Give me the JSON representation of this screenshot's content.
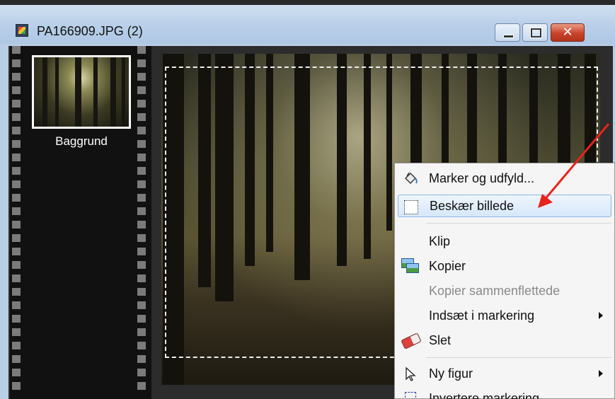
{
  "window": {
    "title": "PA166909.JPG (2)",
    "icon": "image-file-icon",
    "controls": [
      "minimize",
      "maximize",
      "close"
    ]
  },
  "layers": {
    "items": [
      {
        "label": "Baggrund"
      }
    ]
  },
  "context_menu": {
    "items": [
      {
        "label": "Marker og udfyld...",
        "icon": "paint-bucket-icon",
        "enabled": true,
        "submenu": false,
        "highlighted": false
      },
      {
        "label": "Beskær billede",
        "icon": "crop-icon",
        "enabled": true,
        "submenu": false,
        "highlighted": true
      },
      {
        "label": "Klip",
        "icon": null,
        "enabled": true,
        "submenu": false,
        "highlighted": false
      },
      {
        "label": "Kopier",
        "icon": "copy-icon",
        "enabled": true,
        "submenu": false,
        "highlighted": false
      },
      {
        "label": "Kopier sammenflettede",
        "icon": null,
        "enabled": false,
        "submenu": false,
        "highlighted": false
      },
      {
        "label": "Indsæt i markering",
        "icon": null,
        "enabled": true,
        "submenu": true,
        "highlighted": false
      },
      {
        "label": "Slet",
        "icon": "eraser-icon",
        "enabled": true,
        "submenu": false,
        "highlighted": false
      },
      {
        "label": "Ny figur",
        "icon": "pointer-icon",
        "enabled": true,
        "submenu": true,
        "highlighted": false
      },
      {
        "label": "Invertere markering",
        "icon": "invert-selection-icon",
        "enabled": true,
        "submenu": false,
        "highlighted": false
      }
    ]
  },
  "colors": {
    "annotation_arrow": "#e8231c",
    "menu_highlight": "#d6e7fb"
  }
}
